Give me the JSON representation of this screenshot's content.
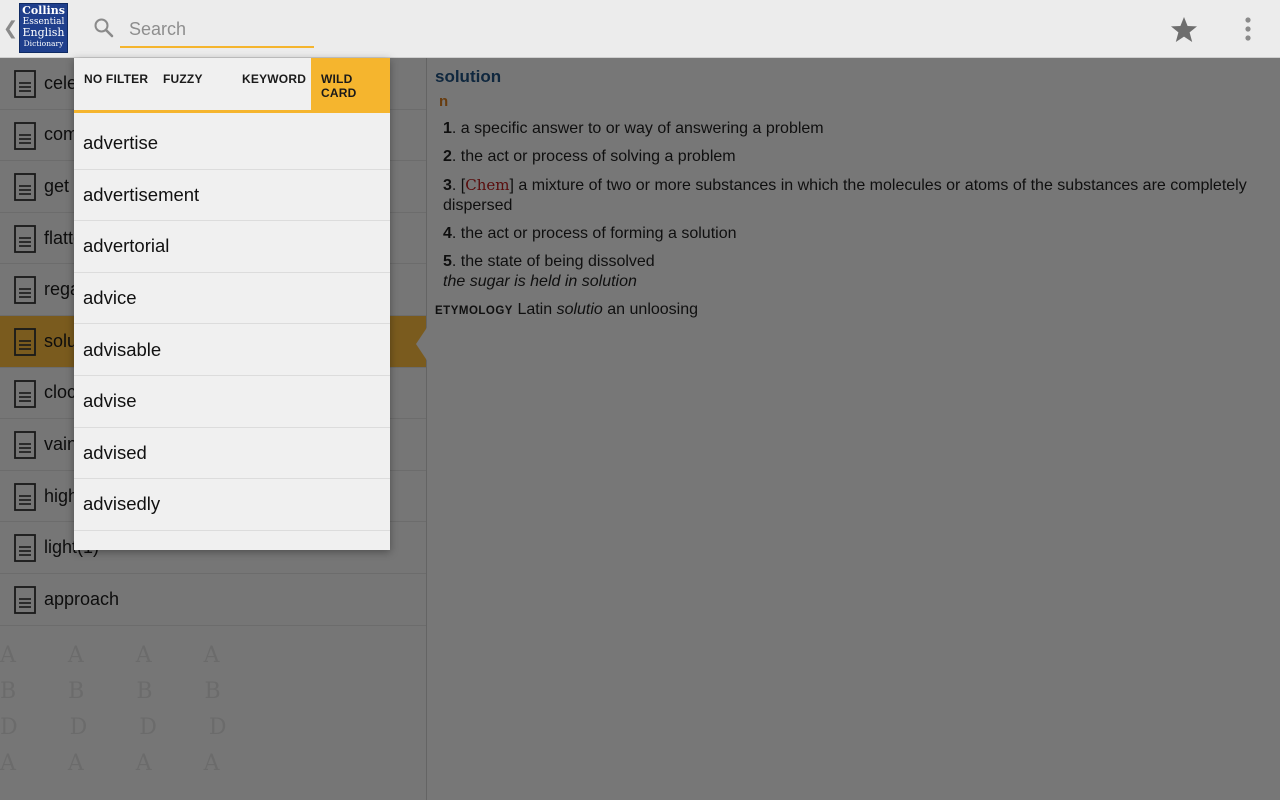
{
  "header": {
    "logo_lines": [
      "Collins",
      "Essential",
      "English",
      "Dictionary"
    ],
    "search_placeholder": "Search",
    "icons": [
      "back-chevron-icon",
      "search-icon",
      "star-icon",
      "overflow-menu-icon"
    ]
  },
  "word_list": {
    "items": [
      {
        "label": "celebrate"
      },
      {
        "label": "combination"
      },
      {
        "label": "get"
      },
      {
        "label": "flatter"
      },
      {
        "label": "regard"
      },
      {
        "label": "solution",
        "selected": true
      },
      {
        "label": "clockwork"
      },
      {
        "label": "vain"
      },
      {
        "label": "high"
      },
      {
        "label": "light(1)"
      },
      {
        "label": "approach"
      }
    ],
    "accent_color": "#f4b63d"
  },
  "entry": {
    "headword": "solution",
    "part_of_speech": "n",
    "senses": [
      {
        "number": "1",
        "text": ". a specific answer to or way of answering a problem"
      },
      {
        "number": "2",
        "text": ". the act or process of solving a problem"
      },
      {
        "number": "3",
        "pre": ". [",
        "label": "Chem",
        "post": "] a mixture of two or more substances in which the molecules or atoms of the substances are completely dispersed"
      },
      {
        "number": "4",
        "text": ". the act or process of forming a solution"
      },
      {
        "number": "5",
        "text": ". the state of being dissolved",
        "example": "the sugar is held in solution"
      }
    ],
    "etymology": {
      "tag": "ETYMOLOGY",
      "pre": "Latin ",
      "italic": "solutio",
      "post": " an unloosing"
    }
  },
  "search_popup": {
    "filters": [
      {
        "label": "NO FILTER",
        "active": false
      },
      {
        "label": "FUZZY",
        "active": false
      },
      {
        "label": "KEYWORD",
        "active": false
      },
      {
        "label": "WILD CARD",
        "active": true
      }
    ],
    "suggestions": [
      "advertise",
      "advertisement",
      "advertorial",
      "advice",
      "advisable",
      "advise",
      "advised",
      "advisedly"
    ]
  }
}
